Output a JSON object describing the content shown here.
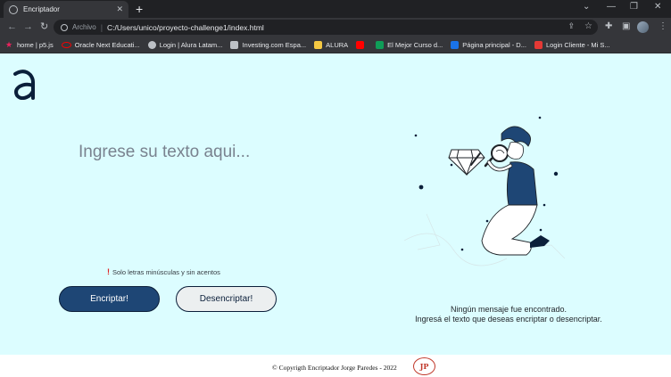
{
  "browser": {
    "tab_title": "Encriptador",
    "new_tab_symbol": "+",
    "url_scheme": "Archivo",
    "url_separator": "|",
    "url": "C:/Users/unico/proyecto-challenge1/index.html"
  },
  "bookmarks": [
    {
      "label": "home | p5.js",
      "icon": "star-icon",
      "color": "#ed225d"
    },
    {
      "label": "Oracle Next Educati...",
      "icon": "oracle-icon",
      "color": "#f80000"
    },
    {
      "label": "Login | Alura Latam...",
      "icon": "alura-icon",
      "color": "#bdc1c6"
    },
    {
      "label": "Investing.com Espa...",
      "icon": "investing-icon",
      "color": "#bdc1c6"
    },
    {
      "label": "ALURA",
      "icon": "folder-icon",
      "color": "#f5c842"
    },
    {
      "label": "",
      "icon": "youtube-icon",
      "color": "#ff0000"
    },
    {
      "label": "El Mejor Curso d...",
      "icon": "check-icon",
      "color": "#0f9d58"
    },
    {
      "label": "Página principal - D...",
      "icon": "dropbox-icon",
      "color": "#1a73e8"
    },
    {
      "label": "Login Cliente - Mi S...",
      "icon": "grid-icon",
      "color": "#e53935"
    }
  ],
  "page": {
    "logo_letter": "a",
    "input_placeholder": "Ingrese su texto aqui...",
    "hint_icon": "!",
    "hint_text": "Solo letras minúsculas y sin acentos",
    "encrypt_label": "Encriptar!",
    "decrypt_label": "Desencriptar!",
    "message_line1": "Ningún mensaje fue encontrado.",
    "message_line2": "Ingresá el texto que deseas encriptar o desencriptar."
  },
  "footer": {
    "copyright": "© Copyrigth Encriptador Jorge Paredes - 2022",
    "badge_text": "JP"
  },
  "colors": {
    "page_bg": "#dcfdff",
    "primary": "#1e4675",
    "dark_navy": "#0b1f3a",
    "placeholder": "#79828f"
  }
}
